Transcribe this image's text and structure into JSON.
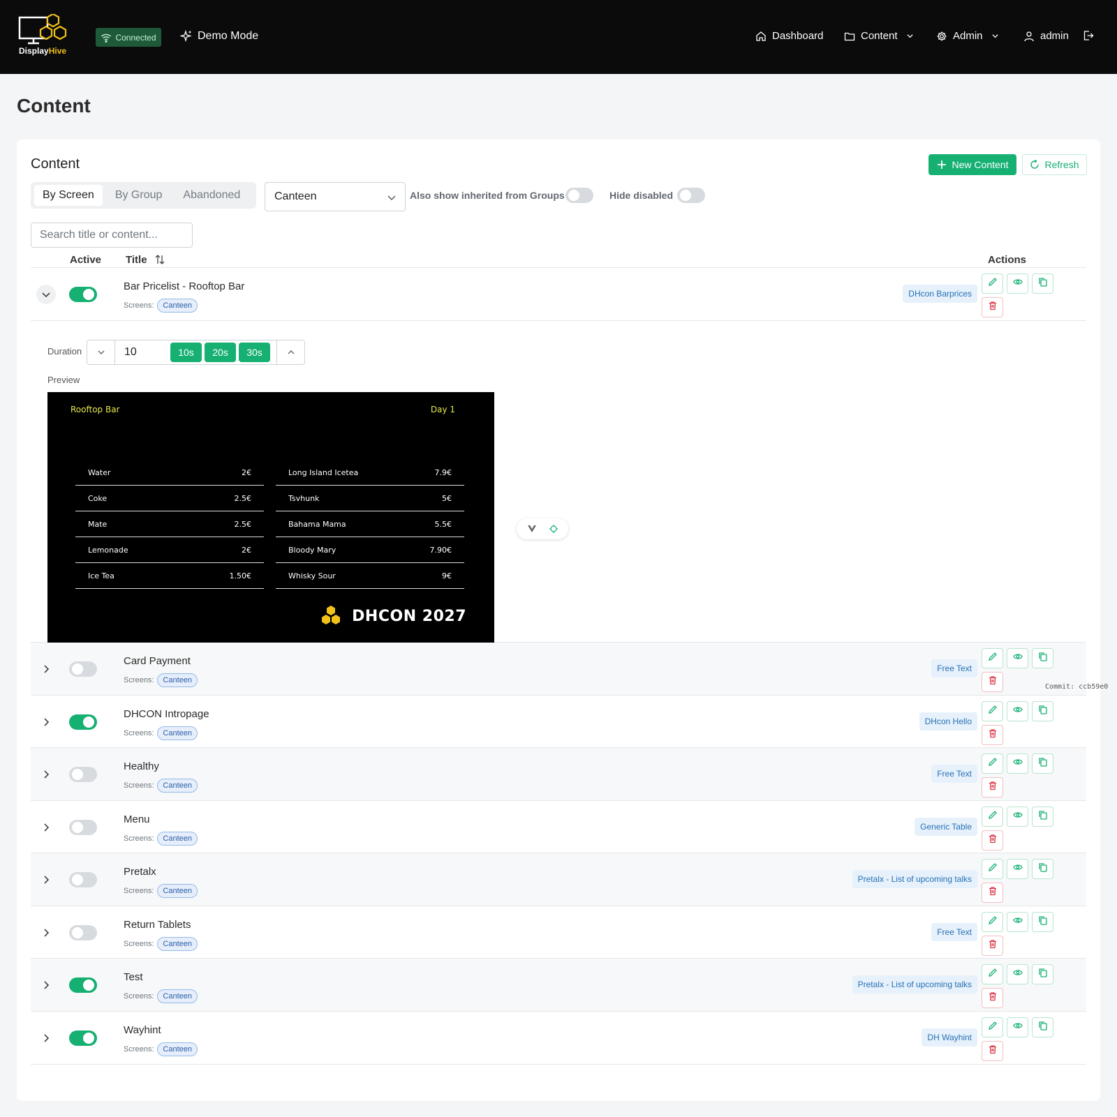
{
  "header": {
    "brand_part1": "Display",
    "brand_part2": "Hive",
    "status": "Connected",
    "demo": "Demo Mode",
    "nav": {
      "dashboard": "Dashboard",
      "content": "Content",
      "admin": "Admin",
      "user": "admin"
    }
  },
  "page": {
    "title": "Content"
  },
  "card": {
    "title": "Content",
    "new_button": "New Content",
    "refresh_button": "Refresh",
    "tabs": [
      "By Screen",
      "By Group",
      "Abandoned"
    ],
    "active_tab": "By Screen",
    "screen_select": "Canteen",
    "inherited_label": "Also show inherited from Groups",
    "inherited_on": false,
    "hide_disabled_label": "Hide disabled",
    "hide_disabled_on": false,
    "search_placeholder": "Search title or content...",
    "columns": {
      "active": "Active",
      "title": "Title",
      "actions": "Actions"
    },
    "screens_label": "Screens:"
  },
  "expanded": {
    "duration_label": "Duration",
    "duration_value": "10",
    "presets": [
      "10s",
      "20s",
      "30s"
    ],
    "preview_label": "Preview",
    "preview": {
      "left_title": "Rooftop Bar",
      "right_title": "Day 1",
      "left_items": [
        {
          "name": "Water",
          "price": "2€"
        },
        {
          "name": "Coke",
          "price": "2.5€"
        },
        {
          "name": "Mate",
          "price": "2.5€"
        },
        {
          "name": "Lemonade",
          "price": "2€"
        },
        {
          "name": "Ice Tea",
          "price": "1.50€"
        }
      ],
      "right_items": [
        {
          "name": "Long Island Icetea",
          "price": "7.9€"
        },
        {
          "name": "Tsvhunk",
          "price": "5€"
        },
        {
          "name": "Bahama Mama",
          "price": "5.5€"
        },
        {
          "name": "Bloody Mary",
          "price": "7.90€"
        },
        {
          "name": "Whisky Sour",
          "price": "9€"
        }
      ],
      "brand": "DHCON 2027"
    }
  },
  "rows": [
    {
      "title": "Bar Pricelist - Rooftop Bar",
      "active": true,
      "screen": "Canteen",
      "type": "DHcon Barprices",
      "expanded": true
    },
    {
      "title": "Card Payment",
      "active": false,
      "screen": "Canteen",
      "type": "Free Text"
    },
    {
      "title": "DHCON Intropage",
      "active": true,
      "screen": "Canteen",
      "type": "DHcon Hello"
    },
    {
      "title": "Healthy",
      "active": false,
      "screen": "Canteen",
      "type": "Free Text"
    },
    {
      "title": "Menu",
      "active": false,
      "screen": "Canteen",
      "type": "Generic Table"
    },
    {
      "title": "Pretalx",
      "active": false,
      "screen": "Canteen",
      "type": "Pretalx - List of upcoming talks"
    },
    {
      "title": "Return Tablets",
      "active": false,
      "screen": "Canteen",
      "type": "Free Text"
    },
    {
      "title": "Test",
      "active": true,
      "screen": "Canteen",
      "type": "Pretalx - List of upcoming talks"
    },
    {
      "title": "Wayhint",
      "active": true,
      "screen": "Canteen",
      "type": "DH Wayhint"
    }
  ],
  "footer": {
    "commit": "Commit: ccb59e0"
  },
  "colors": {
    "accent": "#16b073",
    "header_bg": "#0b0b0b",
    "danger": "#dc3545",
    "badge_bg": "#e6f1fb"
  },
  "icons": [
    "wifi-icon",
    "sparkle-icon",
    "home-icon",
    "folder-icon",
    "gear-icon",
    "user-icon",
    "logout-icon",
    "plus-icon",
    "refresh-icon",
    "chevron-down-icon",
    "chevron-right-icon",
    "sort-icon",
    "pencil-icon",
    "eye-icon",
    "copy-icon",
    "trash-icon"
  ]
}
